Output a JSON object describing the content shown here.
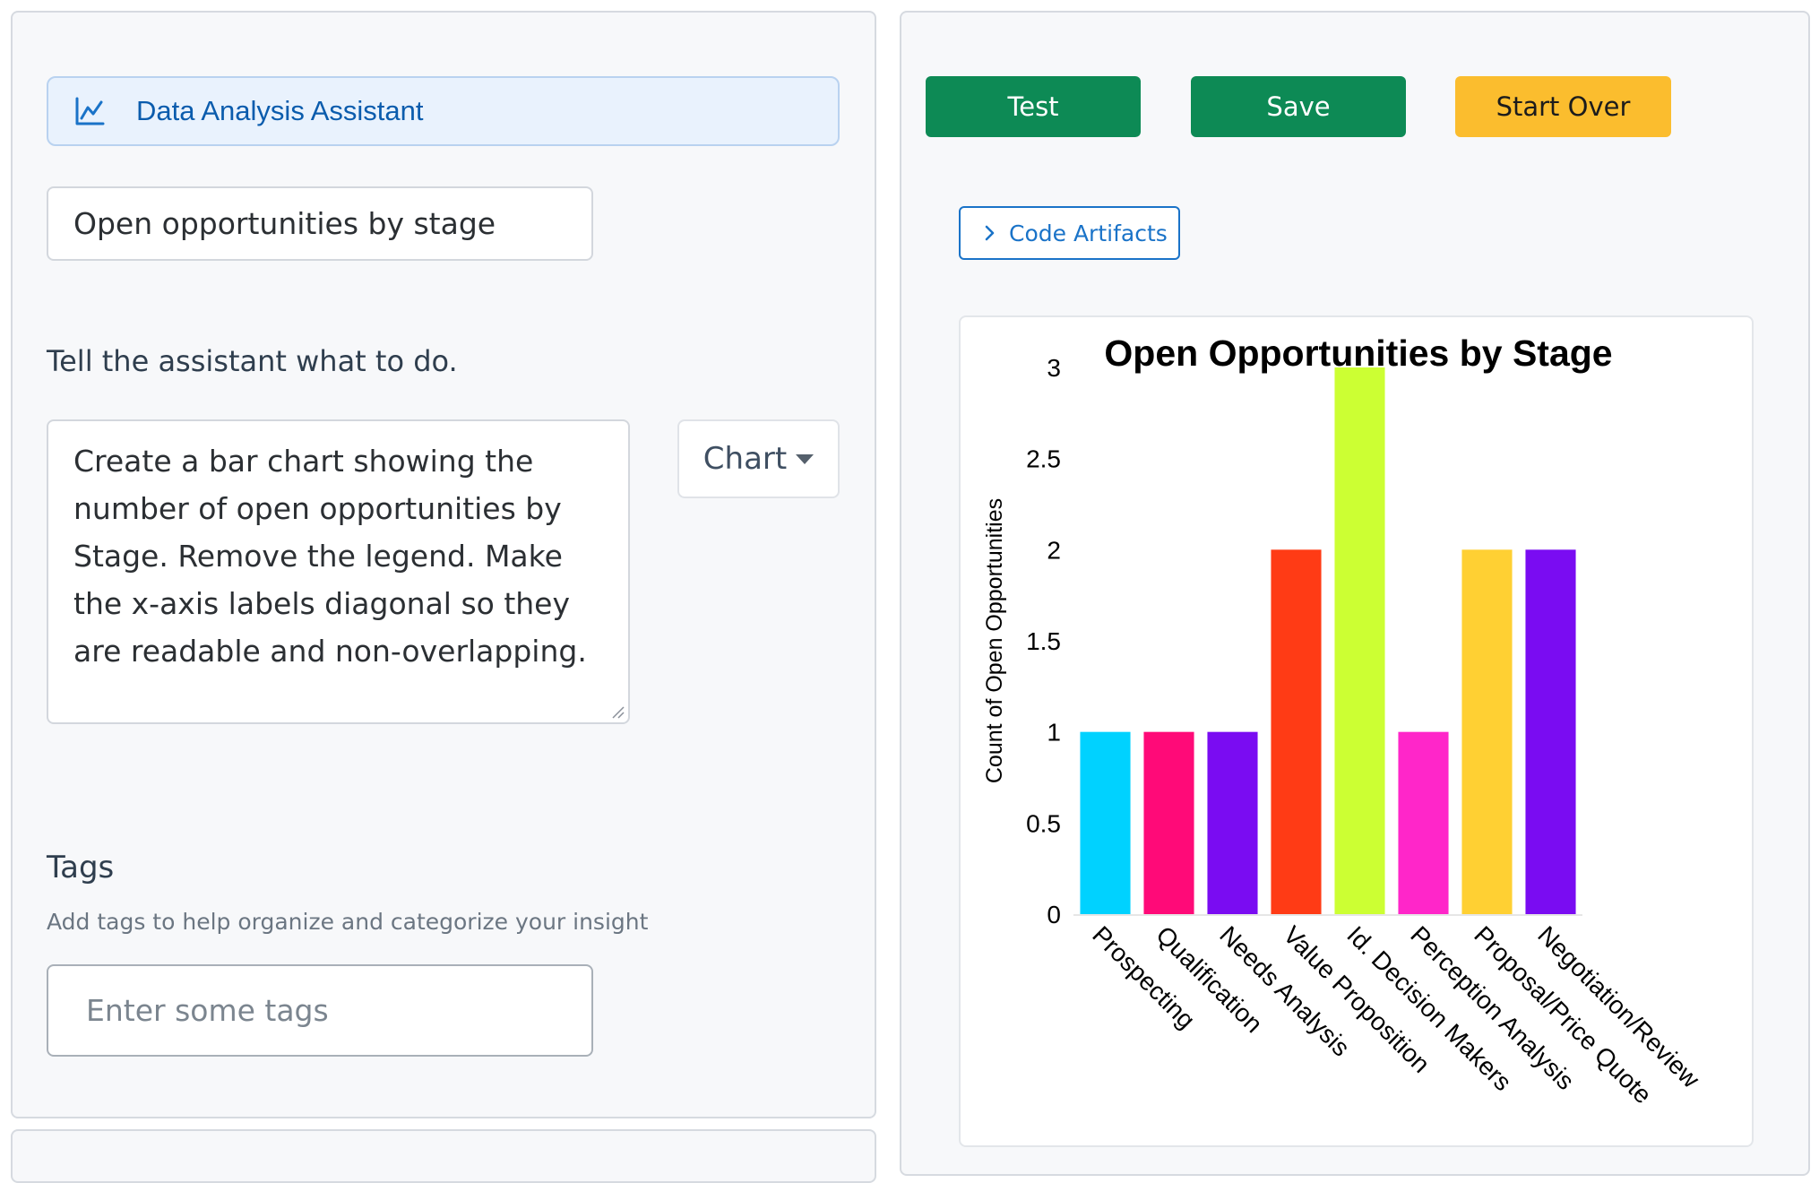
{
  "left": {
    "assistant_label": "Data Analysis Assistant",
    "title_value": "Open opportunities by stage",
    "instructions_label": "Tell the assistant what to do.",
    "prompt_value": "Create a bar chart showing the number of open opportunities by Stage. Remove the legend. Make the x-axis labels diagonal so they are readable and non-overlapping.",
    "output_type": "Chart",
    "tags_title": "Tags",
    "tags_description": "Add tags to help organize and categorize your insight",
    "tags_placeholder": "Enter some tags"
  },
  "toolbar": {
    "test_label": "Test",
    "save_label": "Save",
    "start_over_label": "Start Over"
  },
  "artifacts_label": "Code Artifacts",
  "colors": {
    "accent": "#1a73c8",
    "primary_button": "#0d8a55",
    "warning_button": "#fbbd2e"
  },
  "icons": {
    "assistant": "line-chart-icon",
    "artifacts": "chevron-right-icon",
    "select": "caret-down-icon"
  },
  "chart_data": {
    "type": "bar",
    "title": "Open Opportunities by Stage",
    "xlabel": "",
    "ylabel": "Count of Open Opportunities",
    "categories": [
      "Prospecting",
      "Qualification",
      "Needs Analysis",
      "Value Proposition",
      "Id. Decision Makers",
      "Perception Analysis",
      "Proposal/Price Quote",
      "Negotiation/Review"
    ],
    "values": [
      1,
      1,
      1,
      2,
      3,
      1,
      2,
      2
    ],
    "bar_colors": [
      "#00d2ff",
      "#ff0a78",
      "#7a0cf2",
      "#ff3b15",
      "#ccff33",
      "#ff26c9",
      "#ffd033",
      "#7a0cf2"
    ],
    "yticks": [
      "0",
      "0.5",
      "1",
      "1.5",
      "2",
      "2.5",
      "3"
    ],
    "ylim": [
      0,
      3
    ],
    "legend": false,
    "grid": false
  }
}
